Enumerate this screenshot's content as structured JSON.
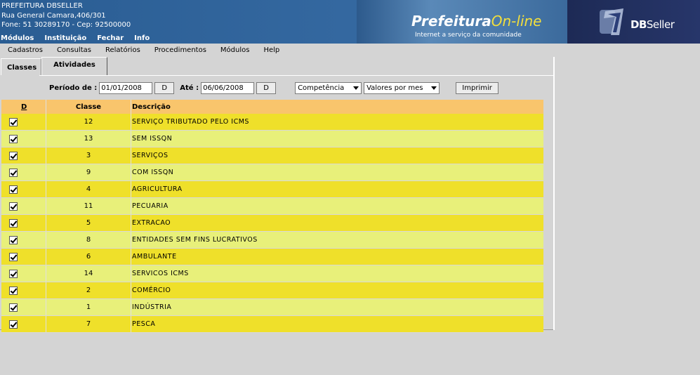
{
  "header": {
    "org_name": "PREFEITURA DBSELLER",
    "address": "Rua General Camara,406/301",
    "contact": "Fone: 51 30289170  -  Cep: 92500000",
    "nav": [
      "Módulos",
      "Instituição",
      "Fechar",
      "Info"
    ],
    "logo_main": "Prefeitura",
    "logo_accent": "On-line",
    "logo_sub": "Internet a serviço da comunidade",
    "vendor_bold": "DB",
    "vendor_light": "Seller"
  },
  "menubar": [
    "Cadastros",
    "Consultas",
    "Relatórios",
    "Procedimentos",
    "Módulos",
    "Help"
  ],
  "tabs": [
    "Classes",
    "Atividades"
  ],
  "filters": {
    "periodo_label": "Período de :",
    "date_from": "01/01/2008",
    "date_btn": "D",
    "ate_label": "Até :",
    "date_to": "06/06/2008",
    "select_1": "Competência",
    "select_2": "Valores por mes",
    "print_label": "Imprimir"
  },
  "table": {
    "headers": {
      "d": "D",
      "classe": "Classe",
      "descricao": "Descrição"
    },
    "rows": [
      {
        "classe": "12",
        "descricao": "SERVIÇO TRIBUTADO PELO ICMS",
        "checked": true
      },
      {
        "classe": "13",
        "descricao": "SEM ISSQN",
        "checked": true
      },
      {
        "classe": "3",
        "descricao": "SERVIÇOS",
        "checked": true
      },
      {
        "classe": "9",
        "descricao": "COM ISSQN",
        "checked": true
      },
      {
        "classe": "4",
        "descricao": "AGRICULTURA",
        "checked": true
      },
      {
        "classe": "11",
        "descricao": "PECUARIA",
        "checked": true
      },
      {
        "classe": "5",
        "descricao": "EXTRACAO",
        "checked": true
      },
      {
        "classe": "8",
        "descricao": "ENTIDADES SEM FINS LUCRATIVOS",
        "checked": true
      },
      {
        "classe": "6",
        "descricao": "AMBULANTE",
        "checked": true
      },
      {
        "classe": "14",
        "descricao": "SERVICOS ICMS",
        "checked": true
      },
      {
        "classe": "2",
        "descricao": "COMÉRCIO",
        "checked": true
      },
      {
        "classe": "1",
        "descricao": "INDÚSTRIA",
        "checked": true
      },
      {
        "classe": "7",
        "descricao": "PESCA",
        "checked": true
      }
    ]
  },
  "colors": {
    "header_blue": "#2a5d93",
    "table_header": "#f9c56c",
    "row_odd": "#efe02a",
    "row_even": "#e8f07a",
    "logo_accent": "#f3df3c"
  }
}
